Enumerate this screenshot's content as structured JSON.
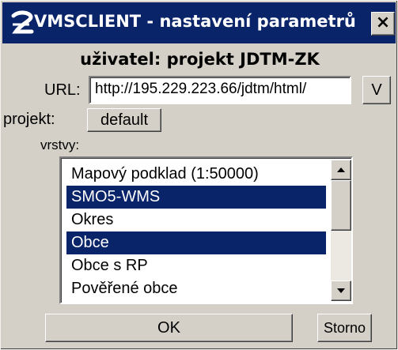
{
  "window": {
    "title": "VMSCLIENT - nastavení parametrů",
    "close_glyph": "×",
    "title_bar_color": "#0a246a",
    "face_color": "#d4d0c8"
  },
  "user": {
    "line": "uživatel: projekt JDTM-ZK"
  },
  "url": {
    "label": "URL:",
    "value": "http://195.229.223.66/jdtm/html/",
    "button_label": "V"
  },
  "project": {
    "label": "projekt:",
    "button_label": "default"
  },
  "layers": {
    "label": "vrstvy:",
    "items": [
      {
        "label": "Mapový podklad (1:50000)",
        "selected": false
      },
      {
        "label": "SMO5-WMS",
        "selected": true
      },
      {
        "label": "Okres",
        "selected": false
      },
      {
        "label": "Obce",
        "selected": true
      },
      {
        "label": "Obce s RP",
        "selected": false
      },
      {
        "label": "Pověřené obce",
        "selected": false
      }
    ],
    "selection_color": "#0a246a"
  },
  "buttons": {
    "ok": "OK",
    "cancel": "Storno"
  },
  "icons": {
    "app": "vmsclient-logo-icon",
    "scroll_up": "arrow-up-icon",
    "scroll_down": "arrow-down-icon"
  }
}
